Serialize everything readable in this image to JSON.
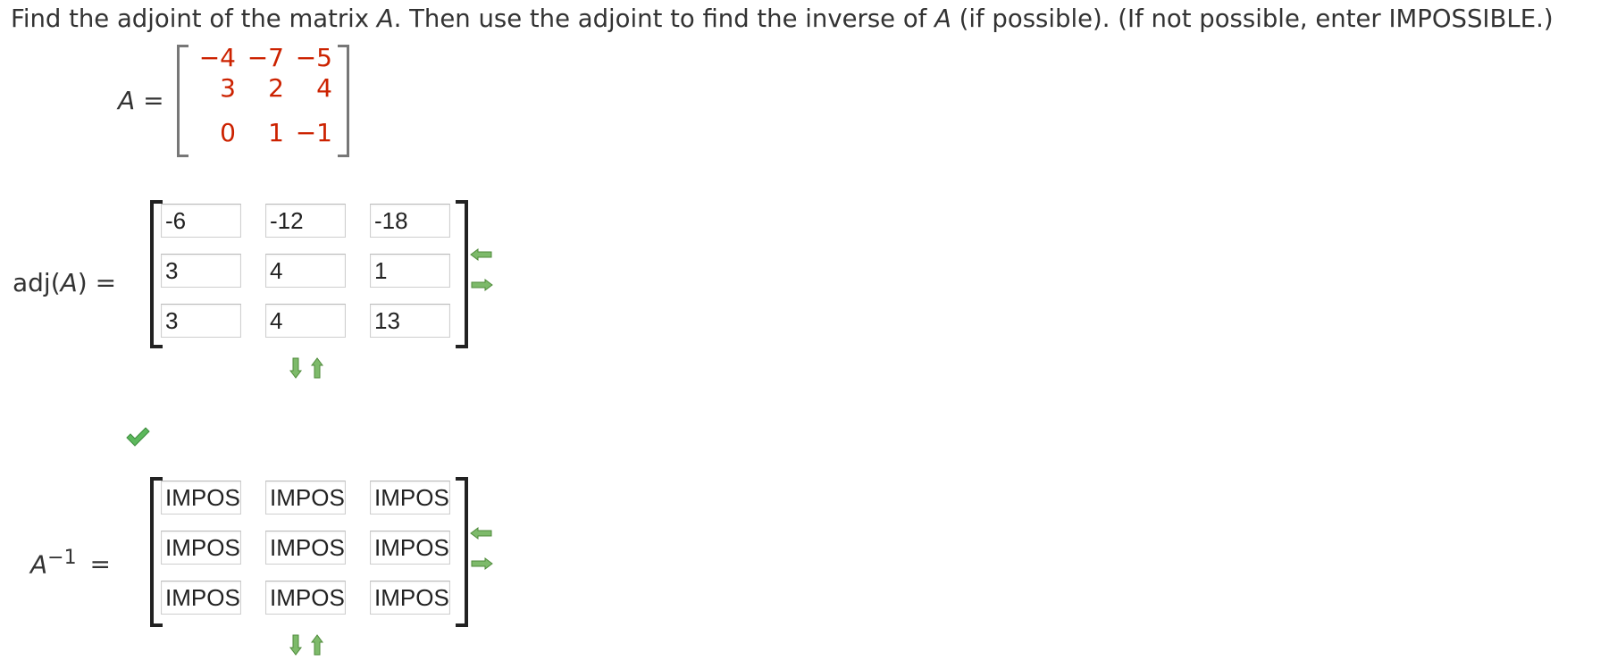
{
  "question": {
    "part1": "Find the adjoint of the matrix ",
    "var1": "A",
    "part2": ". Then use the adjoint to find the inverse of ",
    "var2": "A",
    "part3": " (if possible). (If not possible, enter IMPOSSIBLE.)"
  },
  "matrix_a": {
    "label_var": "A",
    "label_eq": "=",
    "rows": [
      [
        "−4",
        "−7",
        "−5"
      ],
      [
        "3",
        "2",
        "4"
      ],
      [
        "0",
        "1",
        "−1"
      ]
    ]
  },
  "adj": {
    "label_prefix": "adj(",
    "label_var": "A",
    "label_suffix": ") =",
    "cells": [
      [
        "-6",
        "-12",
        "-18"
      ],
      [
        "3",
        "4",
        "1"
      ],
      [
        "3",
        "4",
        "13"
      ]
    ],
    "status": "correct"
  },
  "inverse": {
    "label_var": "A",
    "label_sup": "−1",
    "label_eq": "=",
    "cells": [
      [
        "IMPOSSIBLE",
        "IMPOSSIBLE",
        "IMPOSSIBLE"
      ],
      [
        "IMPOSSIBLE",
        "IMPOSSIBLE",
        "IMPOSSIBLE"
      ],
      [
        "IMPOSSIBLE",
        "IMPOSSIBLE",
        "IMPOSSIBLE"
      ]
    ]
  },
  "colors": {
    "matrix_entries": "#cc2200",
    "arrows": "#6aa84f",
    "check": "#5cb85c"
  },
  "icons": {
    "col_remove": "arrow-left-icon",
    "col_add": "arrow-right-icon",
    "row_add": "arrow-down-icon",
    "row_remove": "arrow-up-icon",
    "status": "checkmark-icon"
  }
}
